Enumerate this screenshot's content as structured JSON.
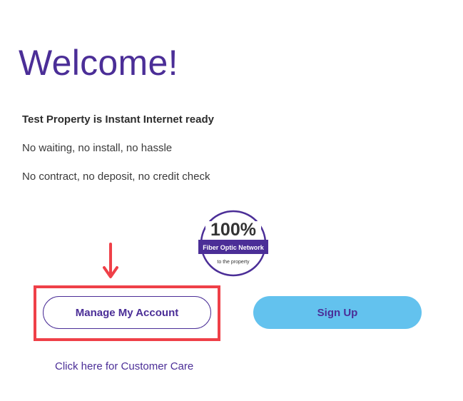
{
  "page": {
    "title": "Welcome!",
    "headline": "Test Property is Instant Internet ready",
    "features": [
      "No waiting, no install, no hassle",
      "No contract, no deposit, no credit check"
    ]
  },
  "badge": {
    "percent": "100%",
    "ribbon": "Fiber Optic Network",
    "caption": "to the property"
  },
  "buttons": {
    "manage_account": "Manage My Account",
    "sign_up": "Sign Up"
  },
  "links": {
    "customer_care": "Click here for Customer Care"
  },
  "colors": {
    "brand_purple": "#4b2e97",
    "sign_up_blue": "#63c2ee",
    "highlight_red": "#ef4048"
  },
  "annotation": {
    "icon": "arrow-down-icon"
  }
}
